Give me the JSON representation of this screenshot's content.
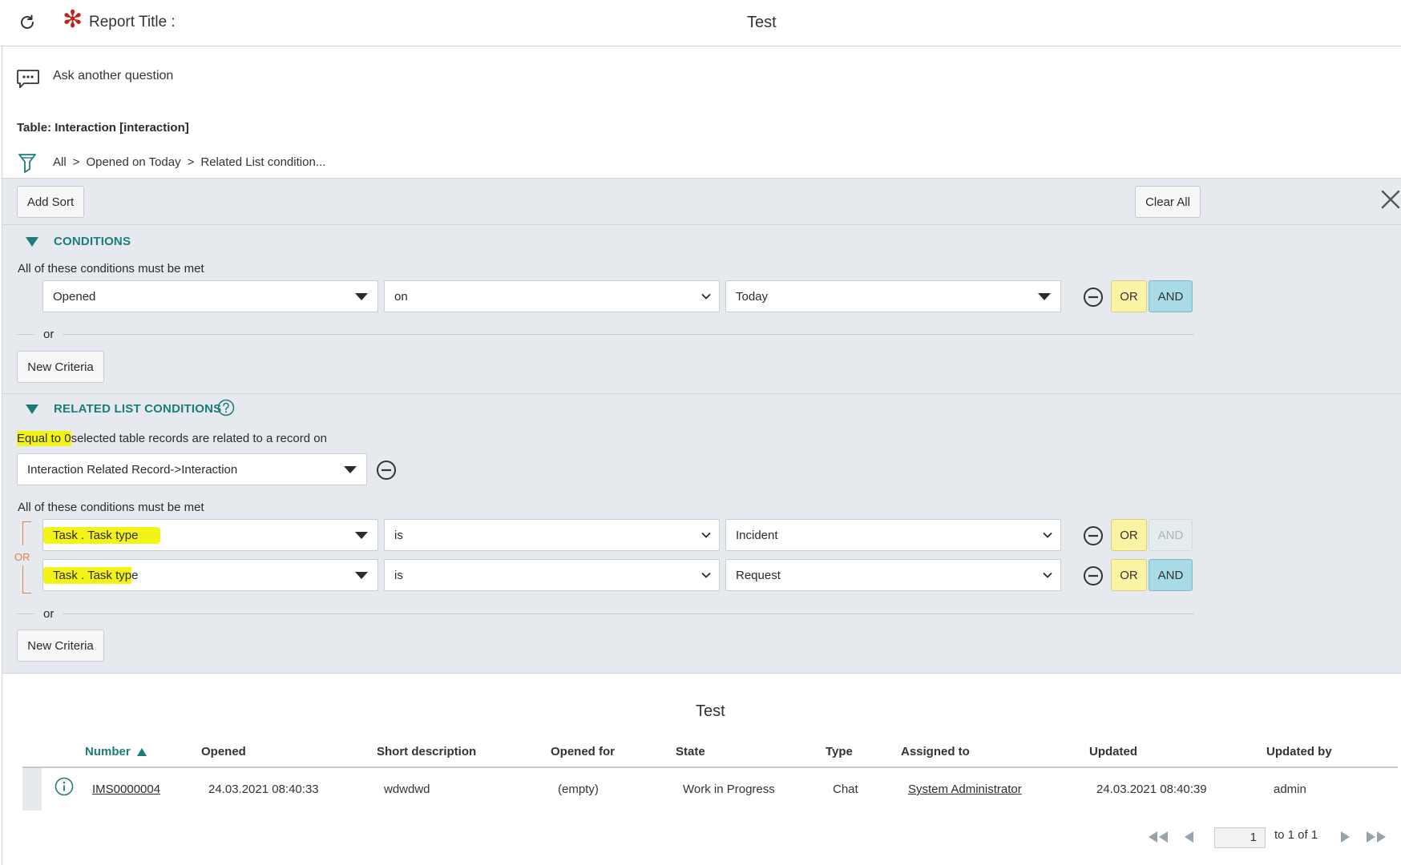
{
  "header": {
    "report_title_label": "Report Title :",
    "report_title_value": "Test"
  },
  "ask": {
    "label": "Ask another question"
  },
  "table": {
    "label": "Table: Interaction [interaction]"
  },
  "breadcrumb": {
    "items": [
      "All",
      "Opened on Today",
      "Related List condition..."
    ],
    "separator": ">"
  },
  "toolbar": {
    "add_sort": "Add Sort",
    "clear_all": "Clear All"
  },
  "conditions": {
    "title": "CONDITIONS",
    "must_be_met": "All of these conditions must be met",
    "row": {
      "field": "Opened",
      "operator": "on",
      "value": "Today"
    },
    "or_label": "or",
    "new_criteria": "New Criteria"
  },
  "related": {
    "title": "RELATED LIST CONDITIONS",
    "quantity_highlight": "Equal to 0",
    "quantity_text": "selected table records are related to a record on",
    "relation": "Interaction Related Record->Interaction",
    "must_be_met": "All of these conditions must be met",
    "or_bracket": "OR",
    "rows": [
      {
        "field": "Task . Task type",
        "operator": "is",
        "value": "Incident"
      },
      {
        "field_highlight": "Task . Task typ",
        "field_rest": "e",
        "operator": "is",
        "value": "Request"
      }
    ],
    "or_label": "or",
    "new_criteria": "New Criteria"
  },
  "buttons": {
    "or": "OR",
    "and": "AND"
  },
  "list": {
    "title": "Test",
    "columns": [
      "Number",
      "Opened",
      "Short description",
      "Opened for",
      "State",
      "Type",
      "Assigned to",
      "Updated",
      "Updated by"
    ],
    "rows": [
      [
        "IMS0000004",
        "24.03.2021 08:40:33",
        "wdwdwd",
        "(empty)",
        "Work in Progress",
        "Chat",
        "System Administrator",
        "24.03.2021 08:40:39",
        "admin"
      ]
    ]
  },
  "pager": {
    "page": "1",
    "of_text": "to 1 of 1"
  },
  "colors": {
    "accent_teal": "#1b7d7a",
    "highlight_yellow": "#f4f316",
    "or_button": "#fbf3a4",
    "and_button": "#a8dbe6",
    "required_red": "#c0221b",
    "builder_bg": "#e6e9ed"
  }
}
